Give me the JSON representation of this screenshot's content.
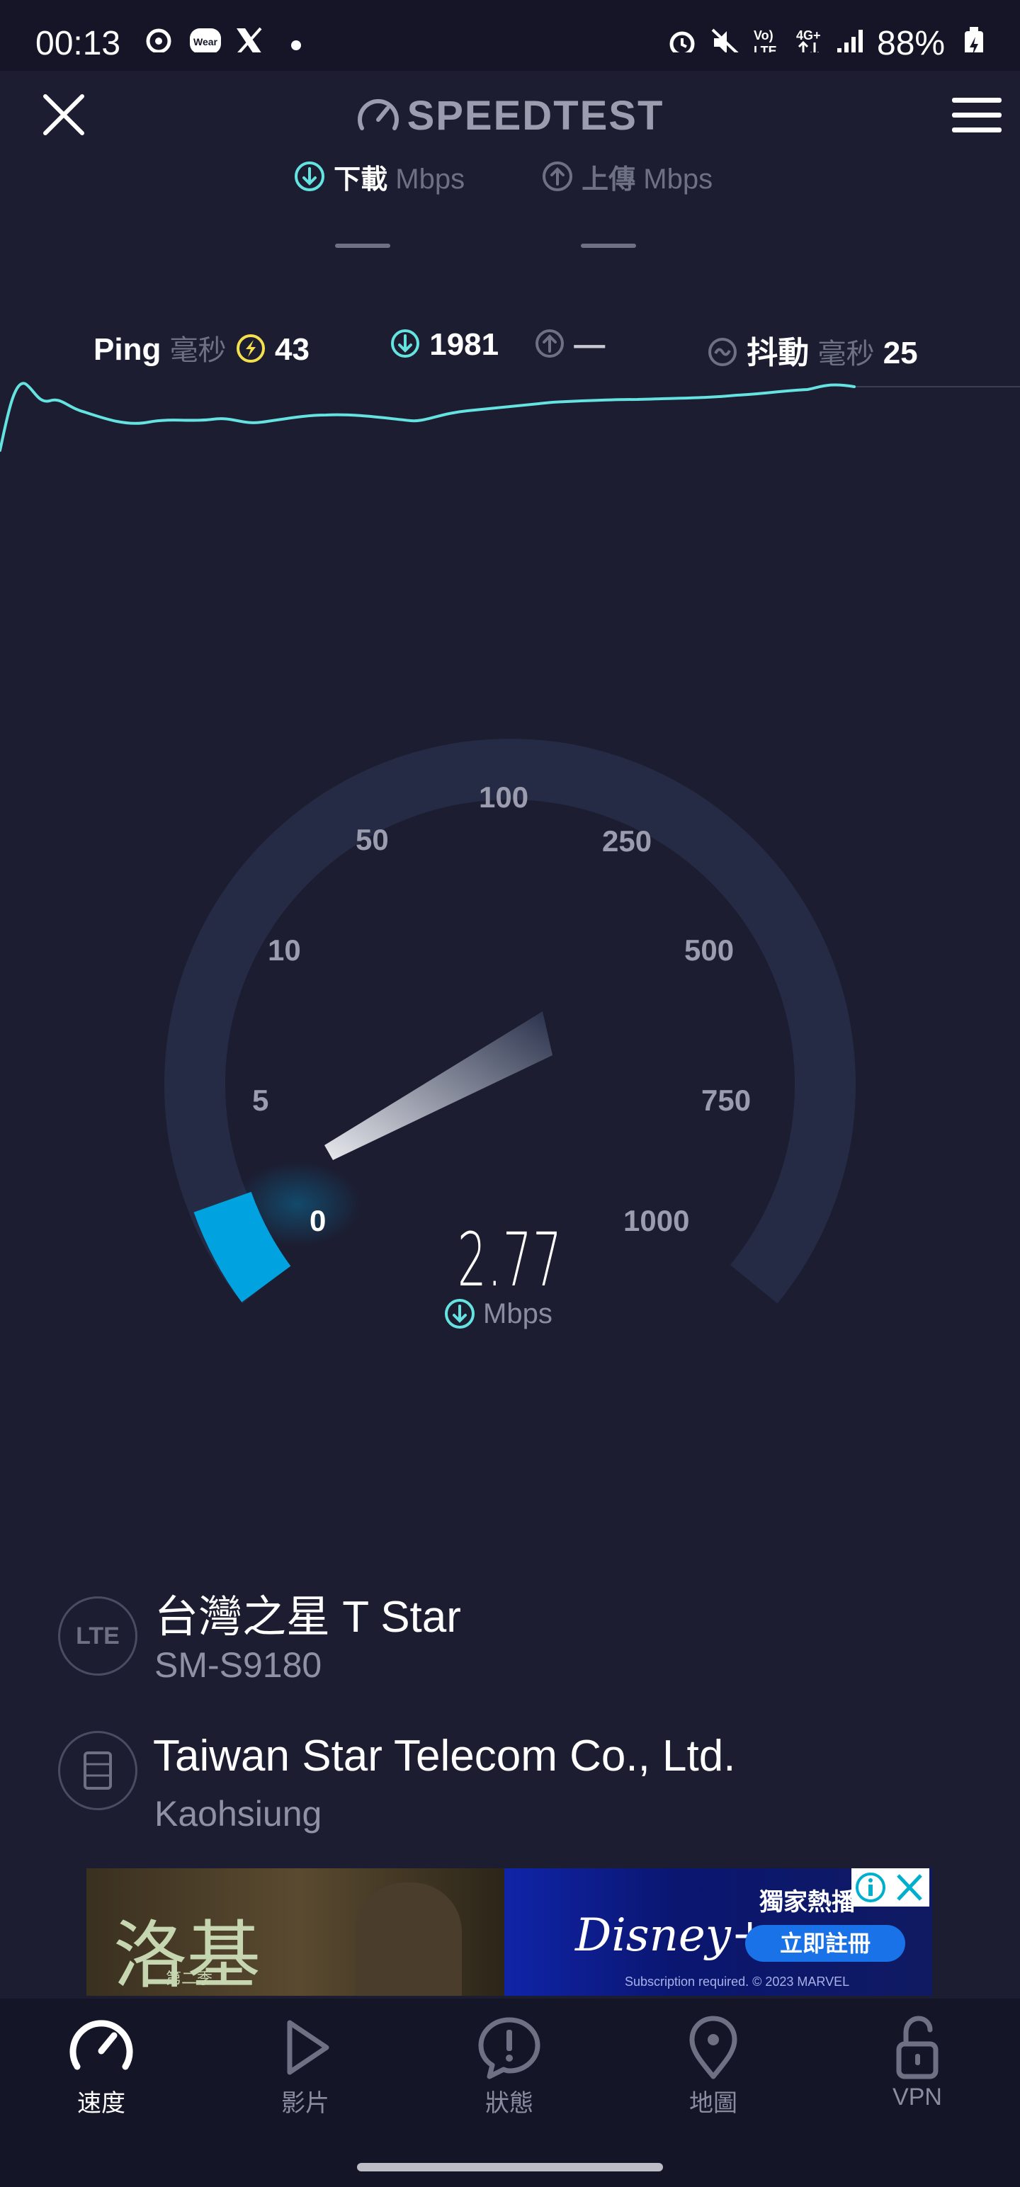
{
  "status_bar": {
    "time": "00:13",
    "battery": "88%",
    "network": "4G+",
    "lte": "VoLTE"
  },
  "header": {
    "title": "SPEEDTEST"
  },
  "tabs": {
    "download_label": "下載",
    "download_unit": "Mbps",
    "upload_label": "上傳",
    "upload_unit": "Mbps"
  },
  "stats": {
    "ping_label": "Ping",
    "ping_unit": "毫秒",
    "ping_value": "43",
    "download_value": "1981",
    "upload_value": "—",
    "jitter_label": "抖動",
    "jitter_unit": "毫秒",
    "jitter_value": "25"
  },
  "gauge": {
    "ticks": [
      "0",
      "5",
      "10",
      "50",
      "100",
      "250",
      "500",
      "750",
      "1000"
    ],
    "speed": "2.77",
    "unit": "Mbps"
  },
  "server": {
    "carrier": "台灣之星 T Star",
    "device": "SM-S9180",
    "provider": "Taiwan Star Telecom Co., Ltd.",
    "location": "Kaohsiung",
    "carrier_badge": "LTE"
  },
  "ad": {
    "title_text": "洛基",
    "subtitle": "第二季",
    "brand": "Disney+",
    "tagline": "獨家熱播",
    "cta": "立即註冊",
    "fine_print": "Subscription required. © 2023 MARVEL"
  },
  "nav": {
    "items": [
      {
        "label": "速度",
        "icon": "speed-icon"
      },
      {
        "label": "影片",
        "icon": "play-icon"
      },
      {
        "label": "狀態",
        "icon": "alert-icon"
      },
      {
        "label": "地圖",
        "icon": "map-pin-icon"
      },
      {
        "label": "VPN",
        "icon": "lock-icon"
      }
    ]
  },
  "colors": {
    "background": "#1c1d31",
    "accent": "#00a3e0",
    "line": "#64e3e0",
    "ping_icon": "#f4e04d"
  }
}
